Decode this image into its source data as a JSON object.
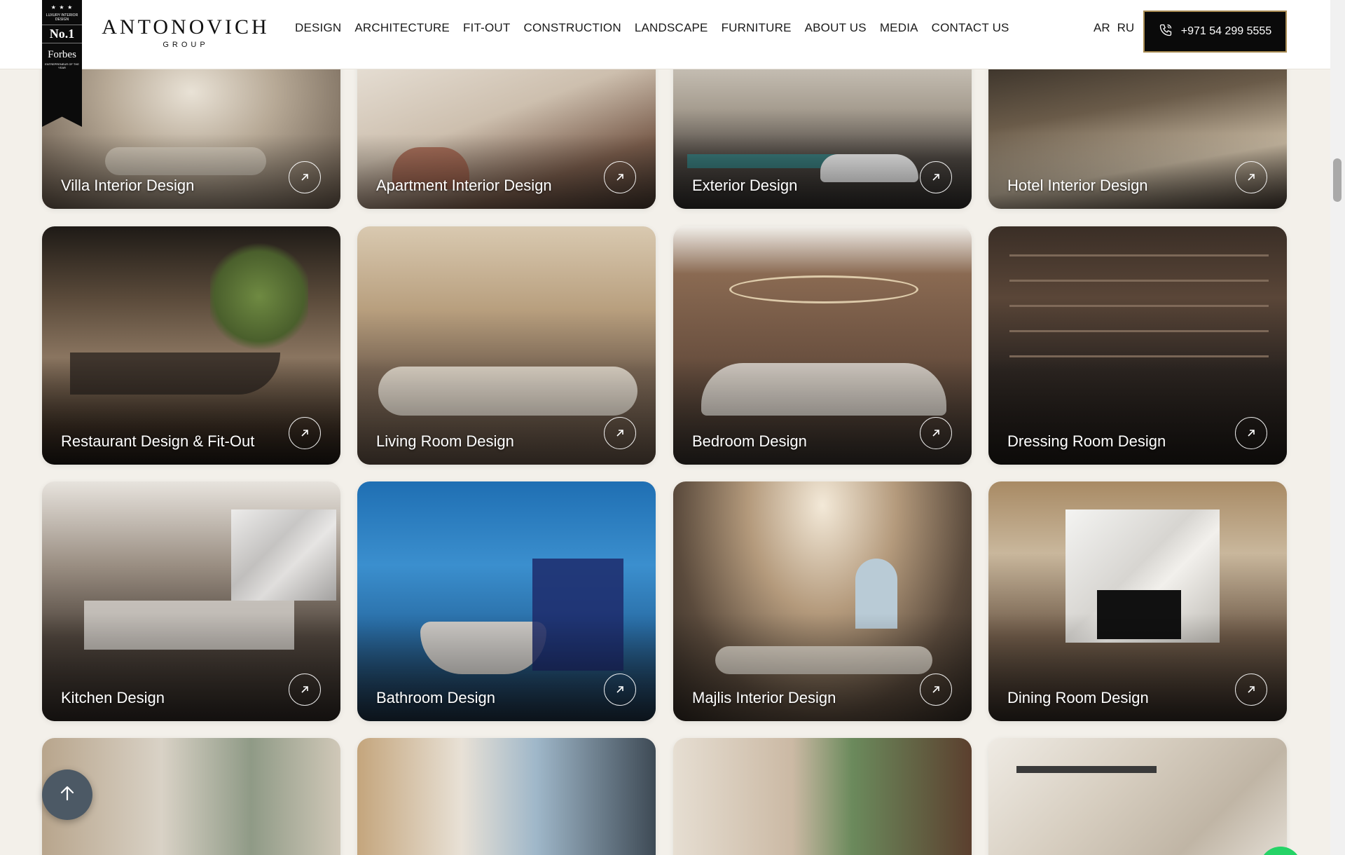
{
  "header": {
    "badge": {
      "stars": "★ ★ ★",
      "tagline": "LUXURY INTERIOR DESIGN",
      "rank": "No.1",
      "publication": "Forbes",
      "award": "ENTREPRENEUR OF THE YEAR"
    },
    "logo": {
      "name": "ANTONOVICH",
      "group": "GROUP"
    },
    "nav": [
      "DESIGN",
      "ARCHITECTURE",
      "FIT-OUT",
      "CONSTRUCTION",
      "LANDSCAPE",
      "FURNITURE",
      "ABOUT US",
      "MEDIA",
      "CONTACT US"
    ],
    "languages": [
      "AR",
      "RU"
    ],
    "phone": "+971 54 299 5555"
  },
  "cards": [
    {
      "label": "Villa Interior Design",
      "icon": "arrow-up-right-icon"
    },
    {
      "label": "Apartment Interior Design",
      "icon": "arrow-up-right-icon"
    },
    {
      "label": "Exterior Design",
      "icon": "arrow-up-right-icon"
    },
    {
      "label": "Hotel Interior Design",
      "icon": "arrow-up-right-icon"
    },
    {
      "label": "Restaurant Design & Fit-Out",
      "icon": "arrow-up-right-icon"
    },
    {
      "label": "Living Room Design",
      "icon": "arrow-up-right-icon"
    },
    {
      "label": "Bedroom Design",
      "icon": "arrow-up-right-icon"
    },
    {
      "label": "Dressing Room Design",
      "icon": "arrow-up-right-icon"
    },
    {
      "label": "Kitchen Design",
      "icon": "arrow-up-right-icon"
    },
    {
      "label": "Bathroom Design",
      "icon": "arrow-up-right-icon"
    },
    {
      "label": "Majlis Interior Design",
      "icon": "arrow-up-right-icon"
    },
    {
      "label": "Dining Room Design",
      "icon": "arrow-up-right-icon"
    },
    {
      "label": "",
      "icon": ""
    },
    {
      "label": "",
      "icon": ""
    },
    {
      "label": "",
      "icon": ""
    },
    {
      "label": "",
      "icon": ""
    }
  ],
  "floating": {
    "back_to_top_icon": "arrow-up-icon"
  },
  "colors": {
    "background": "#f3f0ea",
    "header": "#ffffff",
    "phone_button": "#0a0a0a",
    "phone_border": "#a88b52",
    "back_to_top": "#4c5965"
  }
}
